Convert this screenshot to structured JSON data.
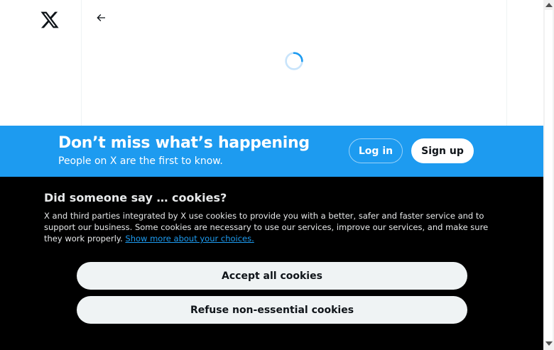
{
  "banner": {
    "headline": "Don’t miss what’s happening",
    "subline": "People on X are the first to know.",
    "login_label": "Log in",
    "signup_label": "Sign up"
  },
  "cookies": {
    "title": "Did someone say … cookies?",
    "body": "X and third parties integrated by X use cookies to provide you with a better, safer and faster service and to support our business. Some cookies are necessary to use our services, improve our services, and make sure they work properly. ",
    "link_label": "Show more about your choices.",
    "accept_label": "Accept all cookies",
    "refuse_label": "Refuse non-essential cookies"
  },
  "icons": {
    "logo": "x-logo-icon",
    "back": "arrow-left-icon",
    "loading": "loading-spinner-icon"
  },
  "colors": {
    "accent": "#1d9bf0",
    "cookie_background": "#000000",
    "light_button": "#eff3f4",
    "text_dark": "#0f1419"
  }
}
